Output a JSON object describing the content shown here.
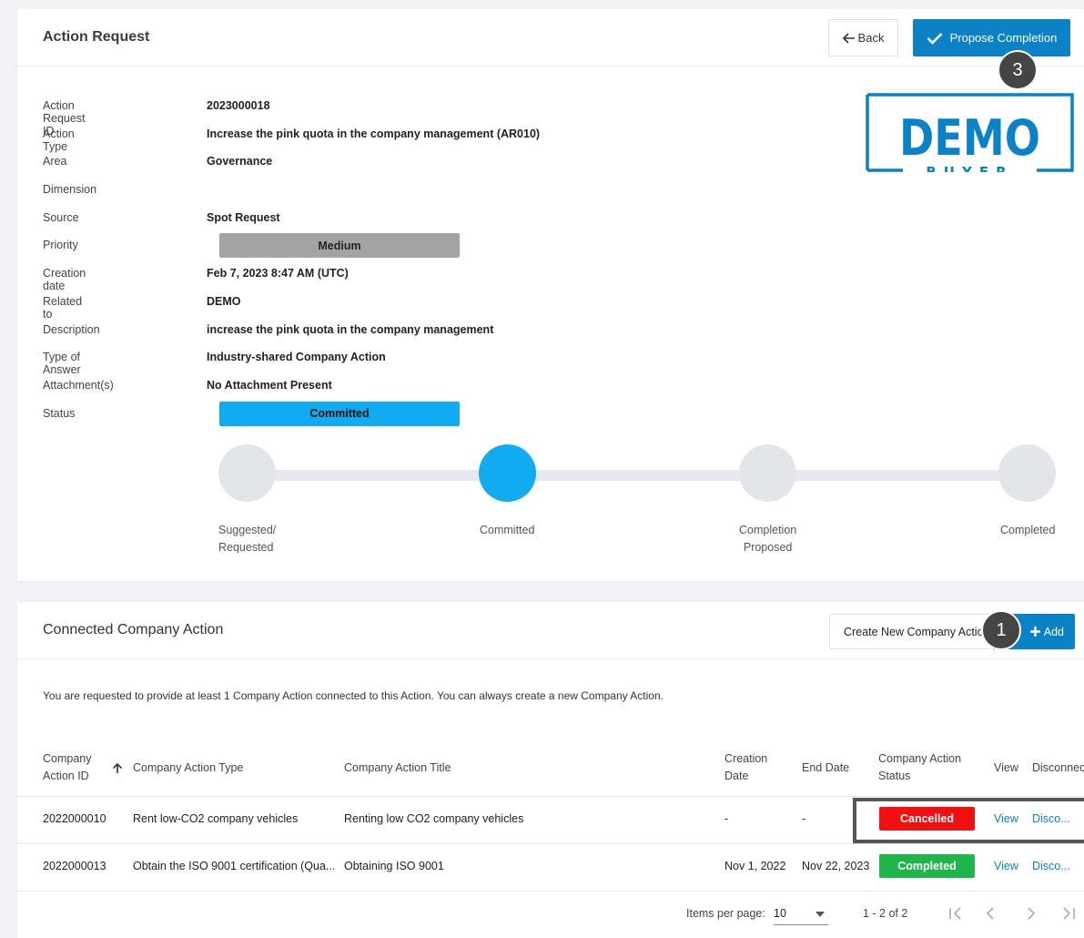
{
  "action_request": {
    "title": "Action Request",
    "back_label": "Back",
    "propose_label": "Propose Completion",
    "badge_3": "3",
    "fields": {
      "id_label": "Action Request ID",
      "id_value": "2023000018",
      "type_label": "Action Type",
      "type_value": "Increase the pink quota in the company management (AR010)",
      "area_label": "Area",
      "area_value": "Governance",
      "dimension_label": "Dimension",
      "dimension_value": "",
      "source_label": "Source",
      "source_value": "Spot Request",
      "priority_label": "Priority",
      "priority_value": "Medium",
      "creation_label": "Creation date",
      "creation_value": "Feb 7, 2023 8:47 AM (UTC)",
      "related_label": "Related to",
      "related_value": "DEMO",
      "description_label": "Description",
      "description_value": "increase the pink quota in the company management",
      "answer_label": "Type of Answer",
      "answer_value": "Industry-shared Company Action",
      "attachment_label": "Attachment(s)",
      "attachment_value": "No Attachment Present",
      "status_label": "Status",
      "status_value": "Committed"
    },
    "logo": {
      "top": "DEMO",
      "bottom": "BUYER"
    },
    "steps": {
      "s1_line1": "Suggested/",
      "s1_line2": "Requested",
      "s2_line1": "Committed",
      "s3_line1": "Completion",
      "s3_line2": "Proposed",
      "s4_line1": "Completed"
    },
    "colors": {
      "primary": "#0b82c6",
      "step_active": "#12aaf0",
      "priority_bg": "#a3a3a3"
    }
  },
  "connected": {
    "title": "Connected Company Action",
    "create_label": "Create New Company Action",
    "add_label": "Add",
    "badge_1": "1",
    "intro": "You are requested to provide at least 1 Company Action connected to this Action. You can always create a new Company Action.",
    "headers": {
      "id_line1": "Company",
      "id_line2": "Action ID",
      "type": "Company Action Type",
      "title": "Company Action Title",
      "creation_line1": "Creation",
      "creation_line2": "Date",
      "end": "End Date",
      "status_line1": "Company Action",
      "status_line2": "Status",
      "view": "View",
      "disconnect": "Disconnect"
    },
    "rows": [
      {
        "id": "2022000010",
        "type": "Rent low-CO2 company vehicles",
        "title": "Renting low CO2 company vehicles",
        "creation": "-",
        "end": "-",
        "status": "Cancelled",
        "status_color": "#f20f0f",
        "view": "View",
        "disconnect": "Disco..."
      },
      {
        "id": "2022000013",
        "type": "Obtain the ISO 9001 certification (Qua...",
        "title": "Obtaining ISO 9001",
        "creation": "Nov 1, 2022",
        "end": "Nov 22, 2023",
        "status": "Completed",
        "status_color": "#1fb54a",
        "view": "View",
        "disconnect": "Disco..."
      }
    ],
    "pager": {
      "items_label": "Items per page:",
      "page_size": "10",
      "range": "1 - 2 of 2"
    }
  }
}
